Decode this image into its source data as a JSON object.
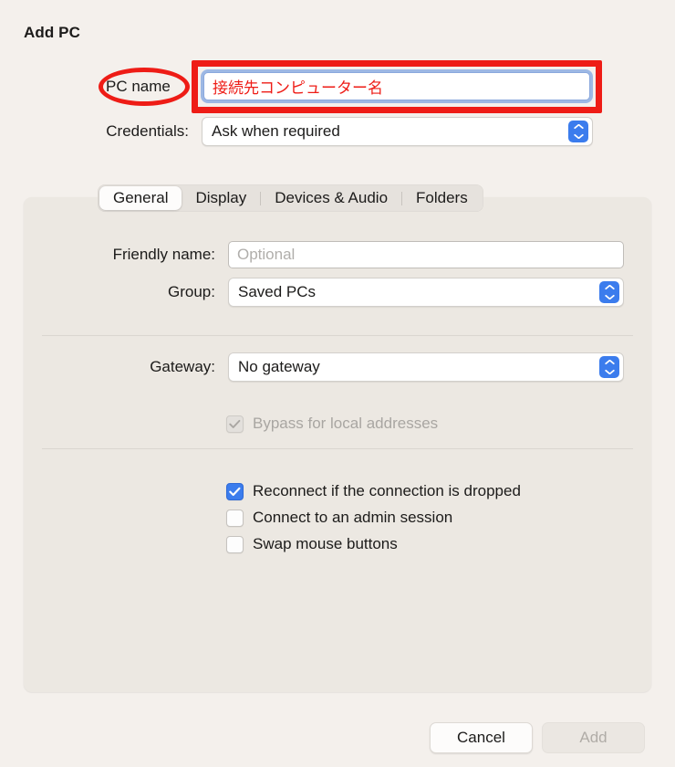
{
  "dialog": {
    "title": "Add PC"
  },
  "top_form": {
    "pc_name": {
      "label": "PC name",
      "value": "接続先コンピューター名",
      "placeholder": "PC name"
    },
    "credentials": {
      "label": "Credentials:",
      "value": "Ask when required"
    }
  },
  "tabs": [
    {
      "label": "General",
      "active": true
    },
    {
      "label": "Display",
      "active": false
    },
    {
      "label": "Devices & Audio",
      "active": false
    },
    {
      "label": "Folders",
      "active": false
    }
  ],
  "general_panel": {
    "friendly_name": {
      "label": "Friendly name:",
      "value": "",
      "placeholder": "Optional"
    },
    "group": {
      "label": "Group:",
      "value": "Saved PCs"
    },
    "gateway": {
      "label": "Gateway:",
      "value": "No gateway"
    },
    "checkboxes": [
      {
        "label": "Bypass for local addresses",
        "checked": true,
        "disabled": true
      },
      {
        "label": "Reconnect if the connection is dropped",
        "checked": true,
        "disabled": false
      },
      {
        "label": "Connect to an admin session",
        "checked": false,
        "disabled": false
      },
      {
        "label": "Swap mouse buttons",
        "checked": false,
        "disabled": false
      }
    ]
  },
  "footer": {
    "cancel_label": "Cancel",
    "add_label": "Add"
  },
  "annotations": {
    "highlight_color": "#ee1c16",
    "oval_target": "PC name",
    "rect_target": "pc-name-input"
  },
  "colors": {
    "window_background": "#f4f0ec",
    "panel_background": "#ece8e2",
    "accent_blue": "#3b7ced",
    "annotation_red": "#ee1c16",
    "text_primary": "#1c1b1a",
    "text_disabled": "#a9a6a2"
  }
}
